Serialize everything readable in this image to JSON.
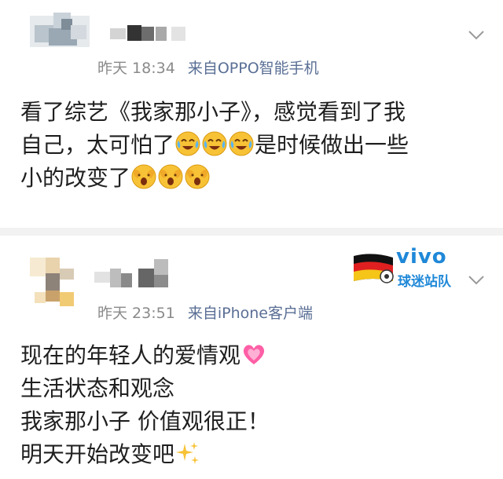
{
  "posts": [
    {
      "timestamp": "昨天 18:34",
      "source": "来自OPPO智能手机",
      "lines": [
        "看了综艺《我家那小子》，感觉看到了我",
        "自己，太可怕了",
        "是时候做出一些",
        "小的改变了"
      ]
    },
    {
      "timestamp": "昨天 23:51",
      "source": "来自iPhone客户端",
      "lines": [
        "现在的年轻人的爱情观",
        "生活状态和观念",
        "我家那小子 价值观很正！",
        "明天开始改变吧"
      ],
      "badge": {
        "brand": "vivo",
        "label": "球迷站队"
      }
    }
  ],
  "icons": {
    "chevron": "chevron-down-icon",
    "emoji_crying": "crying-laughing-emoji-icon",
    "emoji_shocked": "shocked-face-emoji-icon",
    "emoji_heart": "heart-emoji-icon",
    "emoji_sparkles": "sparkles-emoji-icon",
    "flag": "germany-flag-icon"
  },
  "colors": {
    "source_link": "#5a6f95",
    "brand_blue": "#1f88d8"
  }
}
